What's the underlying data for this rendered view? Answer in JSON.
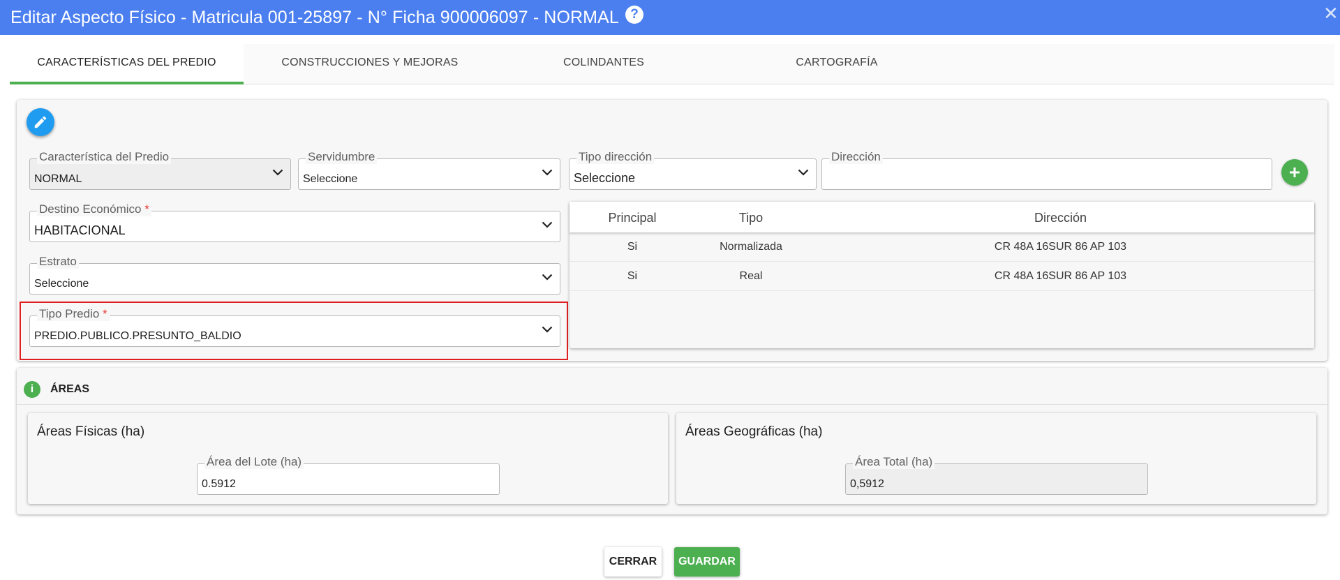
{
  "window": {
    "title": "Editar Aspecto Físico - Matricula 001-25897 - N° Ficha 900006097 - NORMAL",
    "help_glyph": "?",
    "close_glyph": "✕"
  },
  "tabs": [
    {
      "label": "CARACTERÍSTICAS DEL PREDIO",
      "active": true
    },
    {
      "label": "CONSTRUCCIONES Y MEJORAS",
      "active": false
    },
    {
      "label": "COLINDANTES",
      "active": false
    },
    {
      "label": "CARTOGRAFÍA",
      "active": false
    }
  ],
  "form": {
    "caracteristica": {
      "label": "Característica del Predio",
      "value": "NORMAL"
    },
    "servidumbre": {
      "label": "Servidumbre",
      "value": "Seleccione"
    },
    "tipo_direccion": {
      "label": "Tipo dirección",
      "value": "Seleccione"
    },
    "direccion": {
      "label": "Dirección",
      "value": ""
    },
    "destino": {
      "label": "Destino Económico",
      "required": "*",
      "value": "HABITACIONAL"
    },
    "estrato": {
      "label": "Estrato",
      "value": "Seleccione"
    },
    "tipo_predio": {
      "label": "Tipo Predio",
      "required": "*",
      "value": "PREDIO.PUBLICO.PRESUNTO_BALDIO"
    }
  },
  "address_table": {
    "headers": [
      "Principal",
      "Tipo",
      "Dirección"
    ],
    "rows": [
      [
        "Si",
        "Normalizada",
        "CR 48A 16SUR 86 AP 103"
      ],
      [
        "Si",
        "Real",
        "CR 48A 16SUR 86 AP 103"
      ]
    ]
  },
  "areas": {
    "section_title": "ÁREAS",
    "info_glyph": "i",
    "fisicas": {
      "title": "Áreas Físicas (ha)",
      "field_label": "Área del Lote (ha)",
      "value": "0.5912"
    },
    "geograficas": {
      "title": "Áreas Geográficas (ha)",
      "field_label": "Área Total (ha)",
      "value": "0,5912"
    }
  },
  "buttons": {
    "cerrar": "CERRAR",
    "guardar": "GUARDAR"
  },
  "colors": {
    "titlebar": "#4b7ff0",
    "accent_green": "#4caf50",
    "edit_blue": "#1f9cf0",
    "highlight_red": "#e02020"
  },
  "icons": [
    "help-icon",
    "close-icon",
    "pencil-icon",
    "chevron-down-icon",
    "plus-icon",
    "info-icon"
  ]
}
